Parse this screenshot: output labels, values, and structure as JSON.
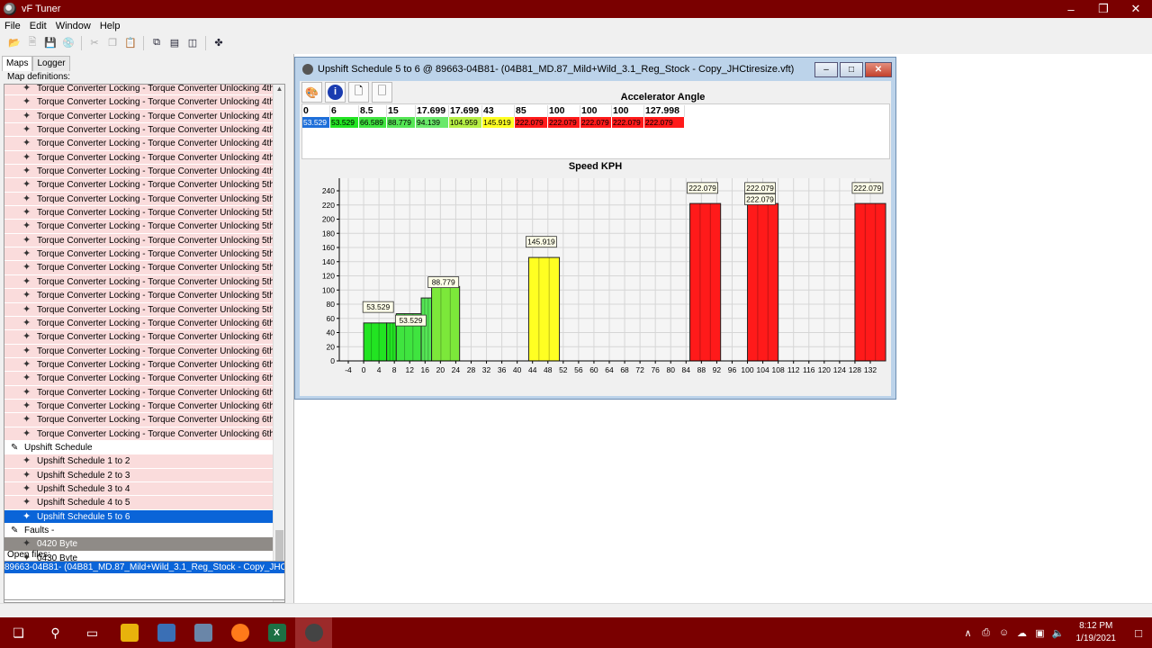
{
  "window": {
    "title": "vF Tuner"
  },
  "menu": [
    "File",
    "Edit",
    "Window",
    "Help"
  ],
  "left_panel": {
    "tabs": [
      "Maps",
      "Logger"
    ],
    "map_definitions_label": "Map definitions:",
    "tree": [
      {
        "label": "Torque Converter Locking - Torque Converter Unlocking 4th Gear",
        "kind": "child"
      },
      {
        "label": "Torque Converter Locking - Torque Converter Unlocking 4th Gear",
        "kind": "child"
      },
      {
        "label": "Torque Converter Locking - Torque Converter Unlocking 4th Gear",
        "kind": "child"
      },
      {
        "label": "Torque Converter Locking - Torque Converter Unlocking 4th Gear",
        "kind": "child"
      },
      {
        "label": "Torque Converter Locking - Torque Converter Unlocking 4th Gear",
        "kind": "child"
      },
      {
        "label": "Torque Converter Locking - Torque Converter Unlocking 4th Gear",
        "kind": "child"
      },
      {
        "label": "Torque Converter Locking - Torque Converter Unlocking 4th Gear",
        "kind": "child"
      },
      {
        "label": "Torque Converter Locking - Torque Converter Unlocking 5th Gear",
        "kind": "child"
      },
      {
        "label": "Torque Converter Locking - Torque Converter Unlocking 5th Gear",
        "kind": "child"
      },
      {
        "label": "Torque Converter Locking - Torque Converter Unlocking 5th Gear",
        "kind": "child"
      },
      {
        "label": "Torque Converter Locking - Torque Converter Unlocking 5th Gear",
        "kind": "child"
      },
      {
        "label": "Torque Converter Locking - Torque Converter Unlocking 5th Gear",
        "kind": "child"
      },
      {
        "label": "Torque Converter Locking - Torque Converter Unlocking 5th Gear",
        "kind": "child"
      },
      {
        "label": "Torque Converter Locking - Torque Converter Unlocking 5th Gear",
        "kind": "child"
      },
      {
        "label": "Torque Converter Locking - Torque Converter Unlocking 5th Gear",
        "kind": "child"
      },
      {
        "label": "Torque Converter Locking - Torque Converter Unlocking 5th Gear",
        "kind": "child"
      },
      {
        "label": "Torque Converter Locking - Torque Converter Unlocking 5th Gear",
        "kind": "child"
      },
      {
        "label": "Torque Converter Locking - Torque Converter Unlocking 6th Gear",
        "kind": "child"
      },
      {
        "label": "Torque Converter Locking - Torque Converter Unlocking 6th Gear",
        "kind": "child"
      },
      {
        "label": "Torque Converter Locking - Torque Converter Unlocking 6th Gear",
        "kind": "child"
      },
      {
        "label": "Torque Converter Locking - Torque Converter Unlocking 6th Gear",
        "kind": "child"
      },
      {
        "label": "Torque Converter Locking - Torque Converter Unlocking 6th Gear",
        "kind": "child"
      },
      {
        "label": "Torque Converter Locking - Torque Converter Unlocking 6th Gear",
        "kind": "child"
      },
      {
        "label": "Torque Converter Locking - Torque Converter Unlocking 6th Gear",
        "kind": "child"
      },
      {
        "label": "Torque Converter Locking - Torque Converter Unlocking 6th Gear",
        "kind": "child"
      },
      {
        "label": "Torque Converter Locking - Torque Converter Unlocking 6th Gear",
        "kind": "child"
      },
      {
        "label": "Upshift Schedule",
        "kind": "group"
      },
      {
        "label": "Upshift Schedule 1 to 2",
        "kind": "child"
      },
      {
        "label": "Upshift Schedule 2 to 3",
        "kind": "child"
      },
      {
        "label": "Upshift Schedule 3 to 4",
        "kind": "child"
      },
      {
        "label": "Upshift Schedule 4 to 5",
        "kind": "child"
      },
      {
        "label": "Upshift Schedule 5 to 6",
        "kind": "child",
        "state": "selected"
      },
      {
        "label": "Faults -",
        "kind": "group"
      },
      {
        "label": "0420 Byte",
        "kind": "child",
        "state": "gray"
      },
      {
        "label": "0430 Byte",
        "kind": "child",
        "state": "plain"
      }
    ],
    "open_files_label": "Open files:",
    "open_file": "89663-04B81- (04B81_MD.87_Mild+Wild_3.1_Reg_Stock - Copy_JHCtiresize.vft)"
  },
  "map_window": {
    "title": "Upshift Schedule 5 to 6 @ 89663-04B81- (04B81_MD.87_Mild+Wild_3.1_Reg_Stock - Copy_JHCtiresize.vft)",
    "axis_title": "Accelerator Angle",
    "chart_title": "Speed KPH",
    "table": {
      "headers": [
        "0",
        "6",
        "8.5",
        "15",
        "17.699",
        "17.699",
        "43",
        "85",
        "100",
        "100",
        "100",
        "127.998"
      ],
      "values": [
        "53.529",
        "53.529",
        "66.589",
        "88.779",
        "94.139",
        "104.959",
        "145.919",
        "222.079",
        "222.079",
        "222.079",
        "222.079",
        "222.079"
      ],
      "cell_colors": [
        "#1e6fd9",
        "#22e422",
        "#3fe43f",
        "#55e655",
        "#6ae86a",
        "#b5ee44",
        "#ffff22",
        "#ff1a1a",
        "#ff1a1a",
        "#ff1a1a",
        "#ff1a1a",
        "#ff1a1a"
      ]
    }
  },
  "chart_data": {
    "type": "bar",
    "title": "Speed KPH",
    "ylim": [
      0,
      250
    ],
    "y_ticks": [
      0,
      20,
      40,
      60,
      80,
      100,
      120,
      140,
      160,
      180,
      200,
      220,
      240
    ],
    "xlim": [
      -4,
      132
    ],
    "x_ticks": [
      -4,
      0,
      4,
      8,
      12,
      16,
      20,
      24,
      28,
      32,
      36,
      40,
      44,
      48,
      52,
      56,
      60,
      64,
      68,
      72,
      76,
      80,
      84,
      88,
      92,
      96,
      100,
      104,
      108,
      112,
      116,
      120,
      124,
      128,
      132
    ],
    "grid": true,
    "bars": [
      {
        "x0": 0,
        "x1": 6,
        "value": 53.529,
        "color": "#22e422"
      },
      {
        "x0": 6,
        "x1": 8.5,
        "value": 53.529,
        "color": "#22e422"
      },
      {
        "x0": 8.5,
        "x1": 15,
        "value": 66.589,
        "color": "#3fe43f"
      },
      {
        "x0": 15,
        "x1": 17.699,
        "value": 88.779,
        "color": "#55e655"
      },
      {
        "x0": 17.699,
        "x1": 25,
        "value": 104.959,
        "color": "#7ce83a"
      },
      {
        "x0": 43,
        "x1": 51,
        "value": 145.919,
        "color": "#ffff22"
      },
      {
        "x0": 85,
        "x1": 93,
        "value": 222.079,
        "color": "#ff1a1a"
      },
      {
        "x0": 100,
        "x1": 108,
        "value": 222.079,
        "color": "#ff1a1a"
      },
      {
        "x0": 128,
        "x1": 136,
        "value": 222.079,
        "color": "#ff1a1a"
      }
    ],
    "labels": [
      {
        "x": 0.5,
        "y": 76,
        "text": "53.529"
      },
      {
        "x": 9,
        "y": 57,
        "text": "53.529"
      },
      {
        "x": 17.5,
        "y": 111,
        "text": "88.779"
      },
      {
        "x": 43,
        "y": 168,
        "text": "145.919"
      },
      {
        "x": 85,
        "y": 244,
        "text": "222.079"
      },
      {
        "x": 100,
        "y": 244,
        "text": "222.079"
      },
      {
        "x": 100,
        "y": 228,
        "text": "222.079"
      },
      {
        "x": 128,
        "y": 244,
        "text": "222.079"
      }
    ]
  },
  "taskbar": {
    "time": "8:12 PM",
    "date": "1/19/2021"
  }
}
